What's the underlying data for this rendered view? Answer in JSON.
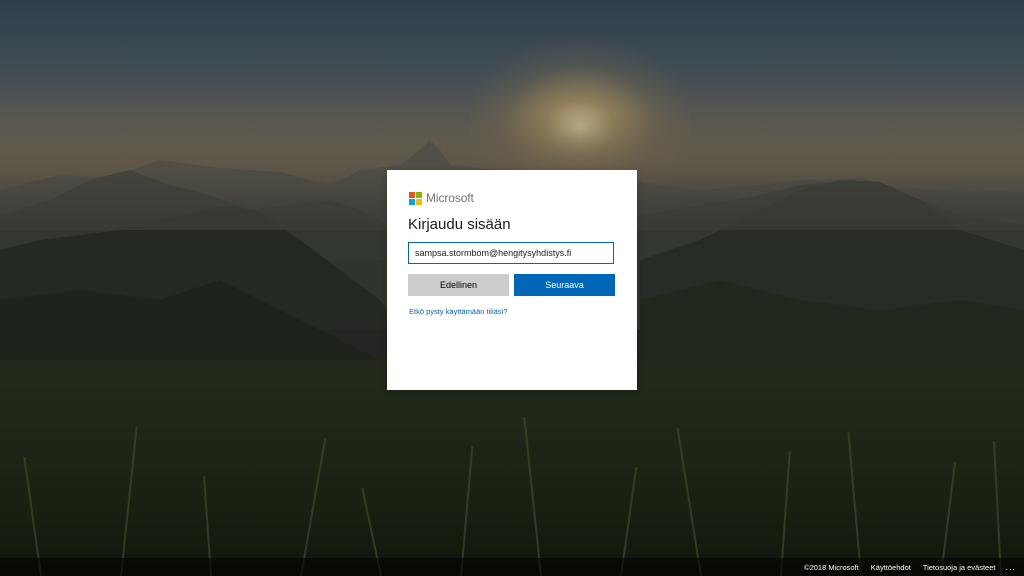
{
  "brand": {
    "name": "Microsoft",
    "colors": {
      "red": "#f25022",
      "green": "#7fba00",
      "blue": "#00a4ef",
      "yellow": "#ffb900"
    }
  },
  "signin": {
    "title": "Kirjaudu sisään",
    "email_value": "sampsa.stormbom@hengitysyhdistys.fi",
    "back_label": "Edellinen",
    "next_label": "Seuraava",
    "cant_access_link": "Etkö pysty käyttämään tiliäsi?"
  },
  "footer": {
    "copyright": "©2018 Microsoft",
    "terms": "Käyttöehdot",
    "privacy": "Tietosuoja ja evästeet",
    "more": "..."
  },
  "theme": {
    "accent": "#0067b8",
    "secondary_button": "#cccccc"
  }
}
